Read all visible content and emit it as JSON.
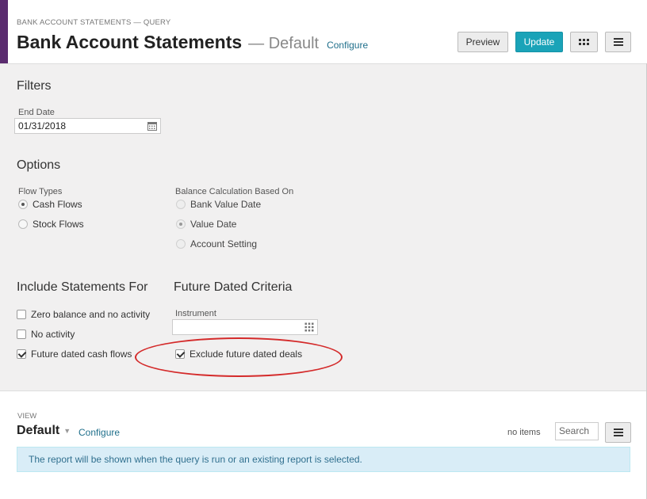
{
  "header": {
    "breadcrumb": "BANK ACCOUNT STATEMENTS — QUERY",
    "title": "Bank Account Statements",
    "subtitle": "— Default",
    "configure_label": "Configure",
    "preview_label": "Preview",
    "update_label": "Update",
    "grid_icon": "grid-icon",
    "menu_icon": "menu-icon"
  },
  "filters": {
    "heading": "Filters",
    "end_date_label": "End Date",
    "end_date_value": "01/31/2018",
    "calendar_icon": "calendar-icon"
  },
  "options": {
    "heading": "Options",
    "flow_types_label": "Flow Types",
    "flow_types": [
      {
        "label": "Cash Flows",
        "selected": true
      },
      {
        "label": "Stock Flows",
        "selected": false
      }
    ],
    "balance_label": "Balance Calculation Based On",
    "balance_options": [
      {
        "label": "Bank Value Date",
        "selected": false
      },
      {
        "label": "Value Date",
        "selected": true
      },
      {
        "label": "Account Setting",
        "selected": false
      }
    ]
  },
  "include": {
    "heading": "Include Statements For",
    "items": [
      {
        "label": "Zero balance and no activity",
        "checked": false
      },
      {
        "label": "No activity",
        "checked": false
      },
      {
        "label": "Future dated cash flows",
        "checked": true
      }
    ]
  },
  "future": {
    "heading": "Future Dated Criteria",
    "instrument_label": "Instrument",
    "instrument_value": "",
    "picker_icon": "grid-picker-icon",
    "exclude_label": "Exclude future dated deals",
    "exclude_checked": true
  },
  "view": {
    "label": "VIEW",
    "name": "Default",
    "configure_label": "Configure",
    "no_items": "no items",
    "search_placeholder": "Search",
    "info_message": "The report will be shown when the query is run or an existing report is selected."
  },
  "colors": {
    "accent": "#5b2c6f",
    "update_button": "#1aa3b8",
    "link": "#1f6f8b",
    "highlight_ellipse": "#d42a2a",
    "info_bg": "#d9edf7"
  }
}
